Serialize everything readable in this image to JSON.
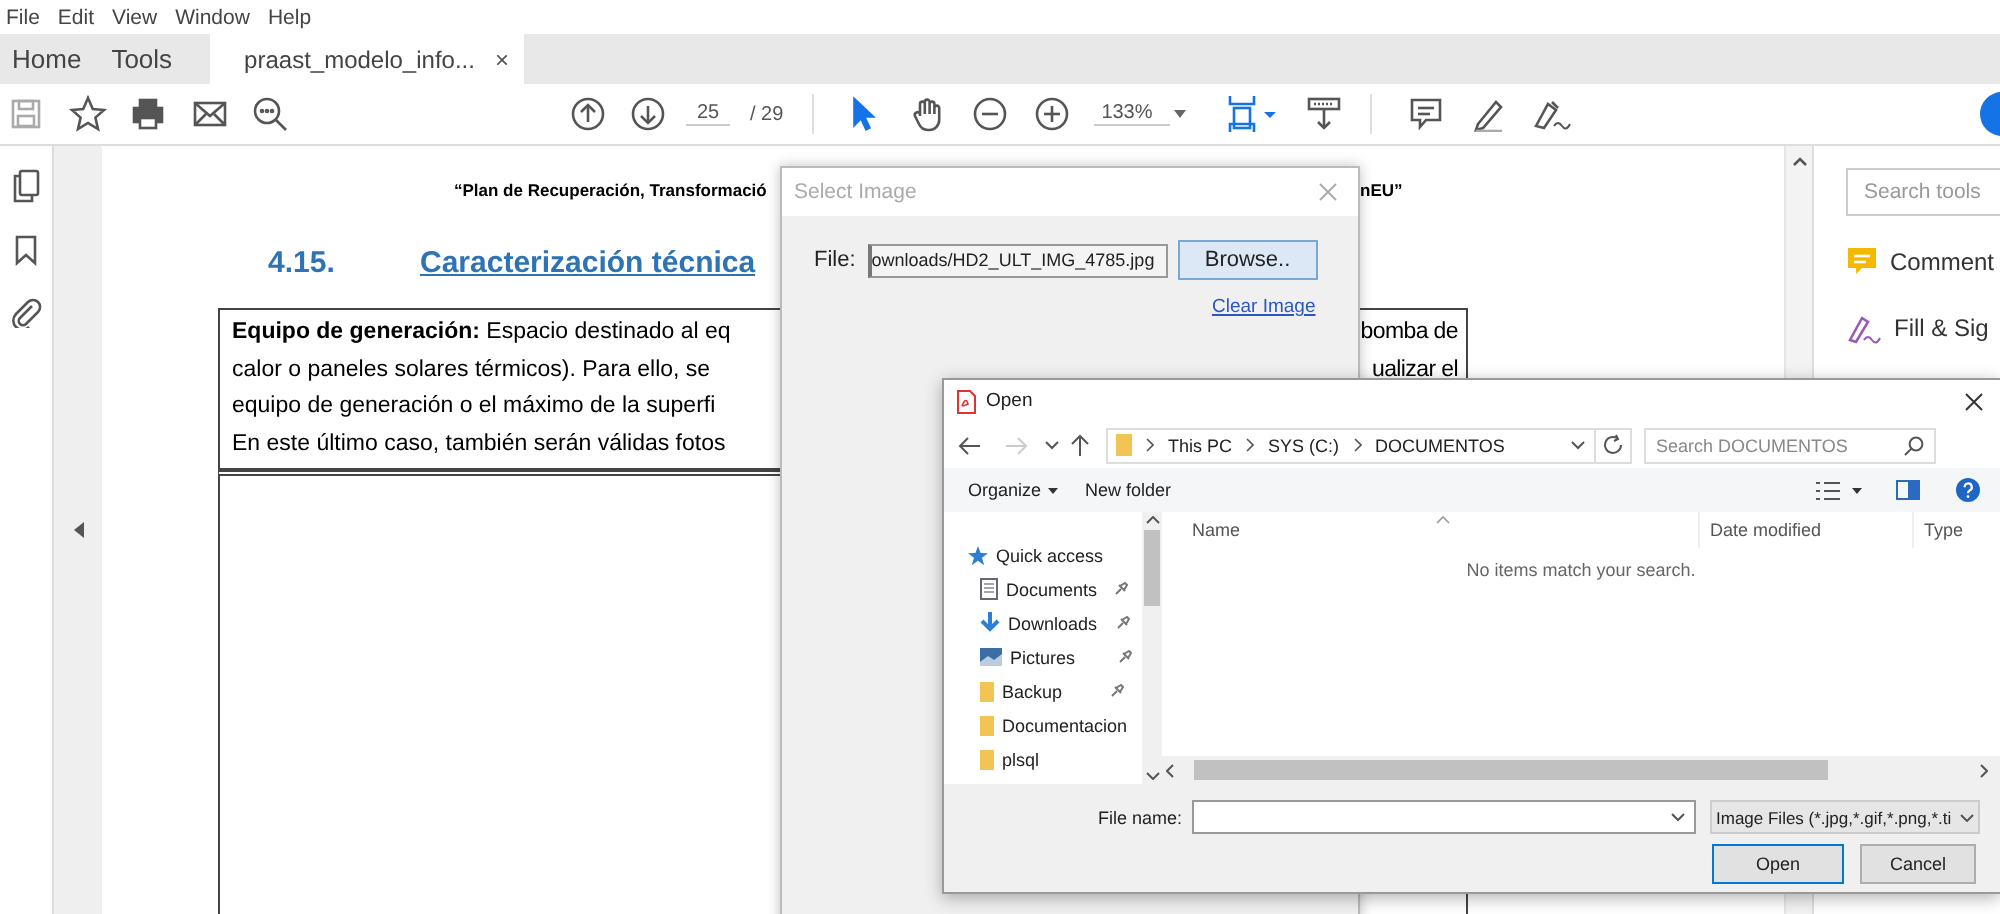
{
  "menu_bar": [
    "File",
    "Edit",
    "View",
    "Window",
    "Help"
  ],
  "tabs": [
    {
      "label": "Home",
      "selected": false
    },
    {
      "label": "Tools",
      "selected": false
    },
    {
      "label": "praast_modelo_info...",
      "selected": true,
      "close": "×"
    }
  ],
  "toolbar": {
    "page_number": "25",
    "page_total": "/ 29",
    "zoom": "133%"
  },
  "document": {
    "header_left": "“Plan de Recuperación, Transformació",
    "header_right": "nEU”",
    "section_number": "4.15.",
    "section_title": "Caracterización técnica",
    "lines": [
      {
        "left": "**Equipo de generación:** Espacio destinado al eq",
        "right": "bomba de"
      },
      {
        "left": "calor o paneles solares térmicos). Para ello, se",
        "right": "ualizar el"
      },
      {
        "left": "equipo de generación o el máximo de la superfi"
      },
      {
        "left": "En este último caso, también serán válidas fotos"
      }
    ]
  },
  "tools_panel": {
    "search": {
      "placeholder": "Search tools"
    },
    "items": [
      {
        "label": "Comment",
        "kind": "comment"
      },
      {
        "label": "Fill & Sig",
        "kind": "sign"
      }
    ]
  },
  "select_image_dialog": {
    "title": "Select Image",
    "file_label": "File:",
    "file_value": "ownloads/HD2_ULT_IMG_4785.jpg",
    "browse_button": "Browse..",
    "clear_link": "Clear Image"
  },
  "open_dialog": {
    "title": "Open",
    "breadcrumb": [
      "This PC",
      "SYS (C:)",
      "DOCUMENTOS"
    ],
    "search": {
      "placeholder": "Search DOCUMENTOS"
    },
    "commands": [
      {
        "label": "Organize",
        "dropdown": true
      },
      {
        "label": "New folder",
        "dropdown": false
      }
    ],
    "nav_items": [
      {
        "label": "Quick access",
        "kind": "star",
        "pinned": false
      },
      {
        "label": "Documents",
        "kind": "document",
        "pinned": true
      },
      {
        "label": "Downloads",
        "kind": "download",
        "pinned": true
      },
      {
        "label": "Pictures",
        "kind": "picture",
        "pinned": true
      },
      {
        "label": "Backup",
        "kind": "folder",
        "pinned": true
      },
      {
        "label": "Documentacion",
        "kind": "folder",
        "pinned": false
      },
      {
        "label": "plsql",
        "kind": "folder",
        "pinned": false
      }
    ],
    "columns": [
      "Name",
      "Date modified",
      "Type"
    ],
    "empty_message": "No items match your search.",
    "file_name_label": "File name:",
    "file_type": "Image Files (*.jpg,*.gif,*.png,*.ti",
    "buttons": [
      {
        "label": "Open",
        "default": true
      },
      {
        "label": "Cancel",
        "default": false
      }
    ]
  }
}
